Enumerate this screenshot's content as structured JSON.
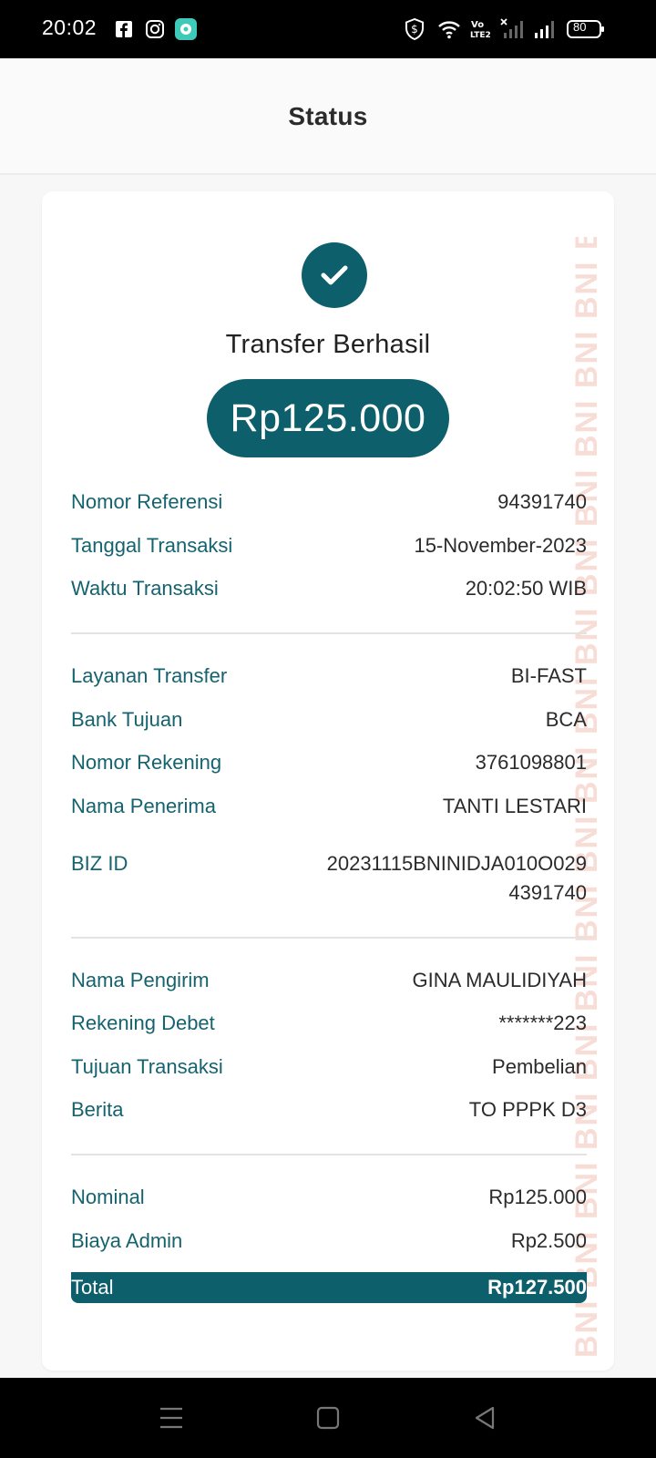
{
  "status_bar": {
    "time": "20:02",
    "battery": "80"
  },
  "header": {
    "title": "Status"
  },
  "result": {
    "title": "Transfer Berhasil",
    "amount": "Rp125.000"
  },
  "watermark": {
    "text": "BNI BNI BNI BNI BNI BNI BNI BNI BNI BNI BNI BNI BNI BNI BNI BNI BNI BNI BNI BNI BNI BNI BNI BNI BNI BNI BNI BN"
  },
  "details": {
    "section1": [
      {
        "label": "Nomor Referensi",
        "value": "94391740"
      },
      {
        "label": "Tanggal Transaksi",
        "value": "15-November-2023"
      },
      {
        "label": "Waktu Transaksi",
        "value": "20:02:50 WIB"
      }
    ],
    "section2": [
      {
        "label": "Layanan Transfer",
        "value": "BI-FAST"
      },
      {
        "label": "Bank Tujuan",
        "value": "BCA"
      },
      {
        "label": "Nomor Rekening",
        "value": "3761098801"
      },
      {
        "label": "Nama Penerima",
        "value": "TANTI LESTARI"
      },
      {
        "label": "BIZ ID",
        "value_line1": "20231115BNINIDJA010O029",
        "value_line2": "4391740"
      }
    ],
    "section3": [
      {
        "label": "Nama Pengirim",
        "value": "GINA MAULIDIYAH"
      },
      {
        "label": "Rekening Debet",
        "value": "*******223"
      },
      {
        "label": "Tujuan Transaksi",
        "value": "Pembelian"
      },
      {
        "label": "Berita",
        "value": "TO PPPK D3"
      }
    ],
    "section4": [
      {
        "label": "Nominal",
        "value": "Rp125.000"
      },
      {
        "label": "Biaya Admin",
        "value": "Rp2.500"
      }
    ],
    "total": {
      "label": "Total",
      "value": "Rp127.500"
    }
  },
  "colors": {
    "primary": "#0d5f6b",
    "label": "#15636f"
  }
}
